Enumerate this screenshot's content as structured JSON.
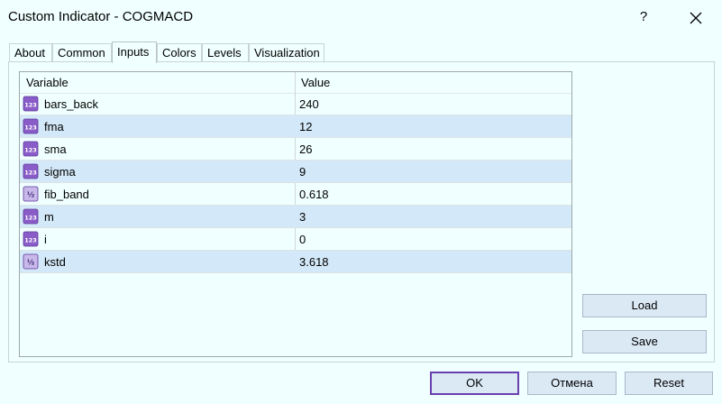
{
  "window": {
    "title": "Custom Indicator - COGMACD",
    "help_label": "?"
  },
  "tabs": [
    {
      "label": "About"
    },
    {
      "label": "Common"
    },
    {
      "label": "Inputs",
      "active": true
    },
    {
      "label": "Colors"
    },
    {
      "label": "Levels"
    },
    {
      "label": "Visualization"
    }
  ],
  "table": {
    "columns": [
      "Variable",
      "Value"
    ],
    "rows": [
      {
        "type_icon": "integer-icon",
        "name": "bars_back",
        "value": "240"
      },
      {
        "type_icon": "integer-icon",
        "name": "fma",
        "value": "12"
      },
      {
        "type_icon": "integer-icon",
        "name": "sma",
        "value": "26"
      },
      {
        "type_icon": "integer-icon",
        "name": "sigma",
        "value": "9"
      },
      {
        "type_icon": "double-icon",
        "name": "fib_band",
        "value": "0.618"
      },
      {
        "type_icon": "integer-icon",
        "name": "m",
        "value": "3"
      },
      {
        "type_icon": "integer-icon",
        "name": "i",
        "value": "0"
      },
      {
        "type_icon": "double-icon",
        "name": "kstd",
        "value": "3.618"
      }
    ]
  },
  "buttons": {
    "load": "Load",
    "save": "Save",
    "ok": "OK",
    "cancel": "Отмена",
    "reset": "Reset"
  },
  "colors": {
    "background": "#f0ffff",
    "row_alt": "#d3e8f8",
    "button": "#dbe9f5",
    "default_button_border": "#6a3fb0",
    "icon_purple": "#8a5cc8"
  }
}
